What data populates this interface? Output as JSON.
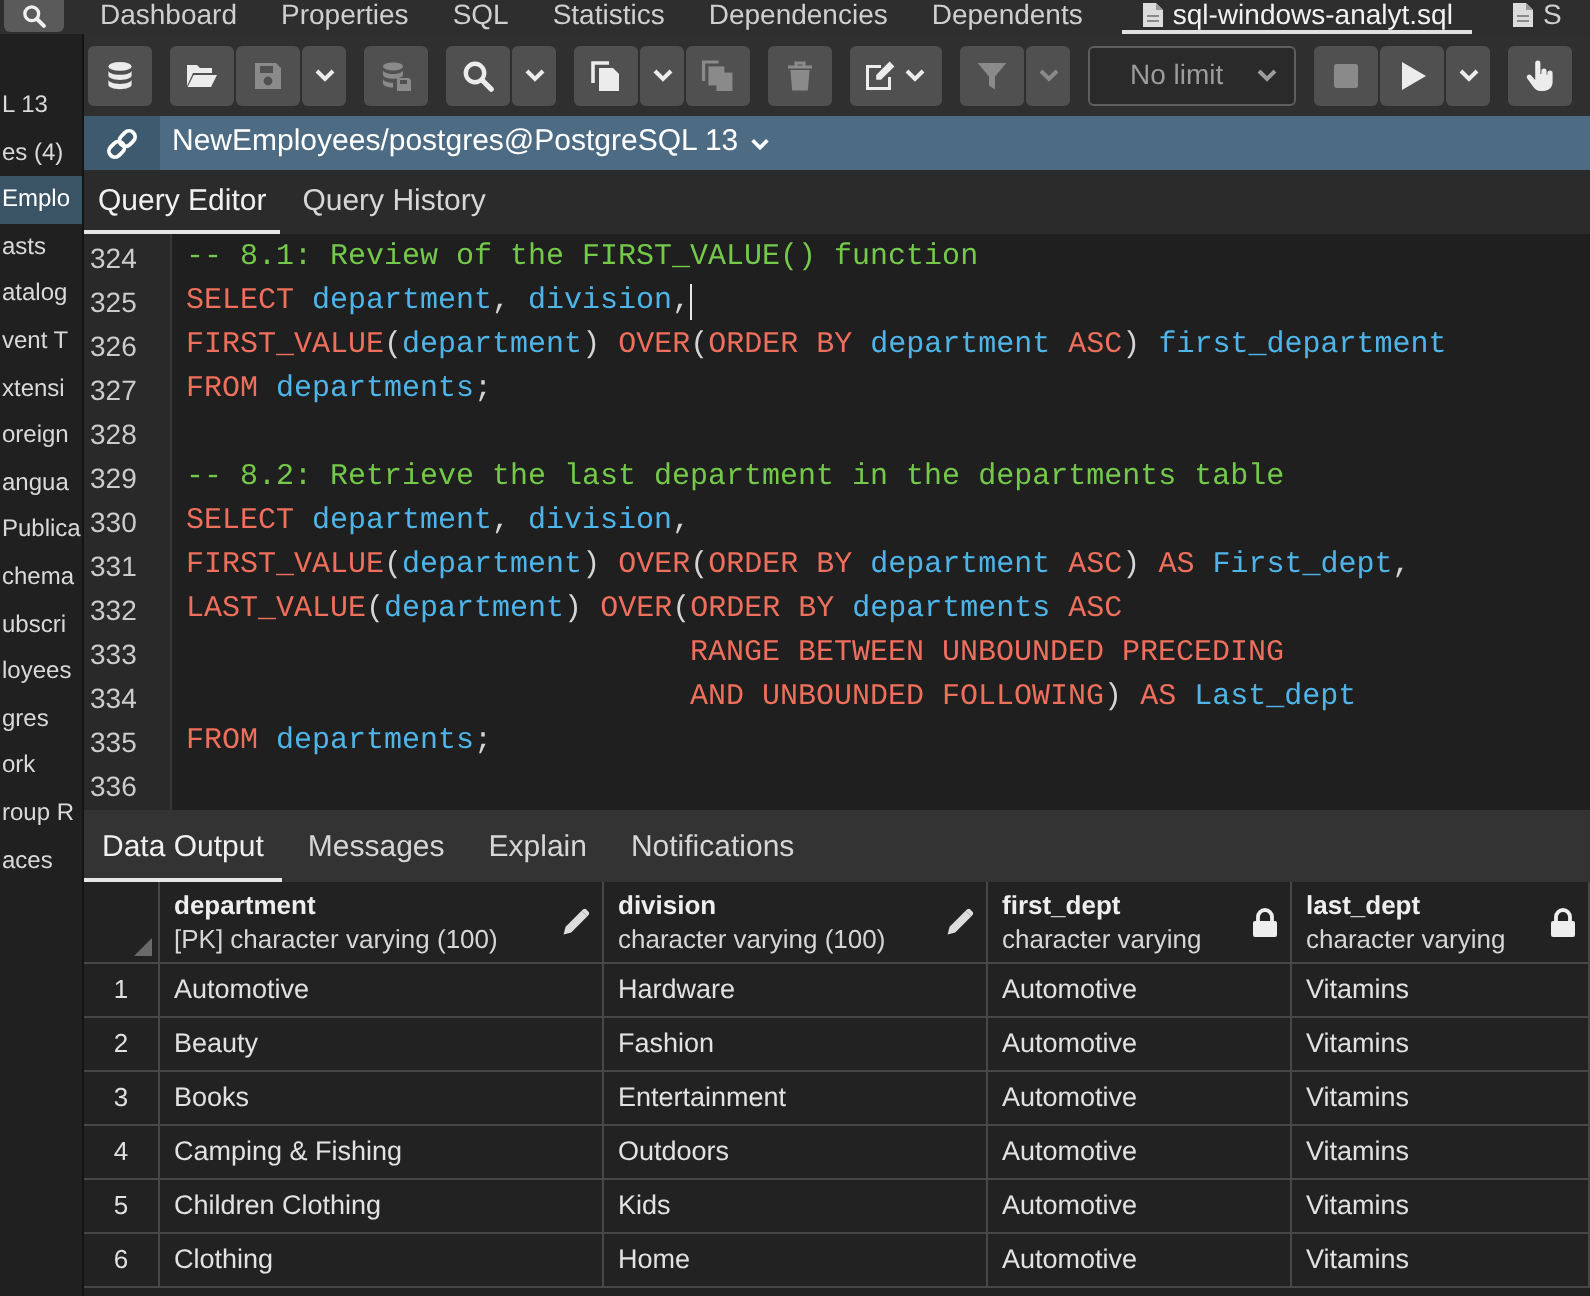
{
  "top_tabs": [
    {
      "label": "Dashboard",
      "selected": false,
      "kind": "plain"
    },
    {
      "label": "Properties",
      "selected": false,
      "kind": "plain"
    },
    {
      "label": "SQL",
      "selected": false,
      "kind": "plain"
    },
    {
      "label": "Statistics",
      "selected": false,
      "kind": "plain"
    },
    {
      "label": "Dependencies",
      "selected": false,
      "kind": "plain"
    },
    {
      "label": "Dependents",
      "selected": false,
      "kind": "plain"
    },
    {
      "label": "sql-windows-analyt.sql",
      "selected": true,
      "kind": "file"
    },
    {
      "label": "S",
      "selected": false,
      "kind": "file"
    }
  ],
  "tree_items": [
    {
      "label": "L 13",
      "selected": false
    },
    {
      "label": "es (4)",
      "selected": false
    },
    {
      "label": "Emplo",
      "selected": true
    },
    {
      "label": "asts",
      "selected": false
    },
    {
      "label": "atalog",
      "selected": false
    },
    {
      "label": "vent T",
      "selected": false
    },
    {
      "label": "xtensi",
      "selected": false
    },
    {
      "label": "oreign",
      "selected": false
    },
    {
      "label": "angua",
      "selected": false
    },
    {
      "label": "Publica",
      "selected": false
    },
    {
      "label": "chema",
      "selected": false
    },
    {
      "label": "ubscri",
      "selected": false
    },
    {
      "label": "loyees",
      "selected": false
    },
    {
      "label": "gres",
      "selected": false
    },
    {
      "label": "ork",
      "selected": false
    },
    {
      "label": "roup R",
      "selected": false
    },
    {
      "label": "aces",
      "selected": false
    }
  ],
  "toolbar": [
    {
      "kind": "buttons",
      "buttons": [
        {
          "kind": "icon",
          "disabled": false
        }
      ]
    },
    {
      "kind": "buttons",
      "buttons": [
        {
          "kind": "icon",
          "disabled": false
        },
        {
          "kind": "icon",
          "disabled": true
        },
        {
          "kind": "caret",
          "disabled": false
        }
      ]
    },
    {
      "kind": "buttons",
      "buttons": [
        {
          "kind": "icon",
          "disabled": true
        }
      ]
    },
    {
      "kind": "buttons",
      "buttons": [
        {
          "kind": "icon",
          "disabled": false
        },
        {
          "kind": "caret",
          "disabled": false
        }
      ]
    },
    {
      "kind": "buttons",
      "buttons": [
        {
          "kind": "icon",
          "disabled": false
        },
        {
          "kind": "caret",
          "disabled": false
        },
        {
          "kind": "icon",
          "disabled": true
        }
      ]
    },
    {
      "kind": "buttons",
      "buttons": [
        {
          "kind": "icon",
          "disabled": true
        }
      ]
    },
    {
      "kind": "buttons",
      "buttons": [
        {
          "kind": "menu",
          "disabled": false
        }
      ]
    },
    {
      "kind": "buttons",
      "buttons": [
        {
          "kind": "icon",
          "disabled": true
        },
        {
          "kind": "caret",
          "disabled": true
        }
      ]
    },
    {
      "kind": "select",
      "value": "No limit"
    },
    {
      "kind": "buttons",
      "buttons": [
        {
          "kind": "icon",
          "disabled": true
        },
        {
          "kind": "icon",
          "disabled": false
        },
        {
          "kind": "caret",
          "disabled": false
        }
      ]
    },
    {
      "kind": "buttons",
      "buttons": [
        {
          "kind": "icon",
          "disabled": false
        }
      ]
    }
  ],
  "connection": {
    "label": "NewEmployees/postgres@PostgreSQL 13"
  },
  "editor_tabs": [
    {
      "label": "Query Editor",
      "selected": true
    },
    {
      "label": "Query History",
      "selected": false
    }
  ],
  "editor": {
    "lines": [
      {
        "number": "324",
        "kind": "line",
        "cursor": false,
        "tokens": [
          {
            "kind": "comment",
            "text": "-- 8.1: Review of the FIRST_VALUE() function"
          }
        ]
      },
      {
        "number": "325",
        "kind": "line",
        "cursor": true,
        "tokens": [
          {
            "kind": "keyword",
            "text": "SELECT "
          },
          {
            "kind": "identifier",
            "text": "department"
          },
          {
            "kind": "plain",
            "text": ", "
          },
          {
            "kind": "identifier",
            "text": "division"
          },
          {
            "kind": "plain",
            "text": ","
          }
        ]
      },
      {
        "number": "326",
        "kind": "line",
        "cursor": false,
        "tokens": [
          {
            "kind": "keyword",
            "text": "FIRST_VALUE"
          },
          {
            "kind": "plain",
            "text": "("
          },
          {
            "kind": "identifier",
            "text": "department"
          },
          {
            "kind": "plain",
            "text": ") "
          },
          {
            "kind": "keyword",
            "text": "OVER"
          },
          {
            "kind": "plain",
            "text": "("
          },
          {
            "kind": "keyword",
            "text": "ORDER BY "
          },
          {
            "kind": "identifier",
            "text": "department "
          },
          {
            "kind": "keyword",
            "text": "ASC"
          },
          {
            "kind": "plain",
            "text": ") "
          },
          {
            "kind": "identifier",
            "text": "first_department"
          }
        ]
      },
      {
        "number": "327",
        "kind": "line",
        "cursor": false,
        "tokens": [
          {
            "kind": "keyword",
            "text": "FROM "
          },
          {
            "kind": "identifier",
            "text": "departments"
          },
          {
            "kind": "plain",
            "text": ";"
          }
        ]
      },
      {
        "number": "328",
        "kind": "blank",
        "cursor": false
      },
      {
        "number": "329",
        "kind": "line",
        "cursor": false,
        "tokens": [
          {
            "kind": "comment",
            "text": "-- 8.2: Retrieve the last department in the departments table"
          }
        ]
      },
      {
        "number": "330",
        "kind": "line",
        "cursor": false,
        "tokens": [
          {
            "kind": "keyword",
            "text": "SELECT "
          },
          {
            "kind": "identifier",
            "text": "department"
          },
          {
            "kind": "plain",
            "text": ", "
          },
          {
            "kind": "identifier",
            "text": "division"
          },
          {
            "kind": "plain",
            "text": ","
          }
        ]
      },
      {
        "number": "331",
        "kind": "line",
        "cursor": false,
        "tokens": [
          {
            "kind": "keyword",
            "text": "FIRST_VALUE"
          },
          {
            "kind": "plain",
            "text": "("
          },
          {
            "kind": "identifier",
            "text": "department"
          },
          {
            "kind": "plain",
            "text": ") "
          },
          {
            "kind": "keyword",
            "text": "OVER"
          },
          {
            "kind": "plain",
            "text": "("
          },
          {
            "kind": "keyword",
            "text": "ORDER BY "
          },
          {
            "kind": "identifier",
            "text": "department "
          },
          {
            "kind": "keyword",
            "text": "ASC"
          },
          {
            "kind": "plain",
            "text": ") "
          },
          {
            "kind": "keyword",
            "text": "AS "
          },
          {
            "kind": "identifier",
            "text": "First_dept"
          },
          {
            "kind": "plain",
            "text": ","
          }
        ]
      },
      {
        "number": "332",
        "kind": "line",
        "cursor": false,
        "tokens": [
          {
            "kind": "keyword",
            "text": "LAST_VALUE"
          },
          {
            "kind": "plain",
            "text": "("
          },
          {
            "kind": "identifier",
            "text": "department"
          },
          {
            "kind": "plain",
            "text": ") "
          },
          {
            "kind": "keyword",
            "text": "OVER"
          },
          {
            "kind": "plain",
            "text": "("
          },
          {
            "kind": "keyword",
            "text": "ORDER BY "
          },
          {
            "kind": "identifier",
            "text": "departments "
          },
          {
            "kind": "keyword",
            "text": "ASC"
          }
        ]
      },
      {
        "number": "333",
        "kind": "continuation",
        "cursor": false,
        "tokens": [
          {
            "kind": "keyword",
            "text": "RANGE BETWEEN UNBOUNDED PRECEDING"
          }
        ]
      },
      {
        "number": "334",
        "kind": "continuation",
        "cursor": false,
        "tokens": [
          {
            "kind": "keyword",
            "text": "AND UNBOUNDED FOLLOWING"
          },
          {
            "kind": "plain",
            "text": ") "
          },
          {
            "kind": "keyword",
            "text": "AS "
          },
          {
            "kind": "identifier",
            "text": "Last_dept"
          }
        ]
      },
      {
        "number": "335",
        "kind": "line",
        "cursor": false,
        "tokens": [
          {
            "kind": "keyword",
            "text": "FROM "
          },
          {
            "kind": "identifier",
            "text": "departments"
          },
          {
            "kind": "plain",
            "text": ";"
          }
        ]
      },
      {
        "number": "336",
        "kind": "blank",
        "cursor": false
      }
    ]
  },
  "output_tabs": [
    {
      "label": "Data Output",
      "selected": true
    },
    {
      "label": "Messages",
      "selected": false
    },
    {
      "label": "Explain",
      "selected": false
    },
    {
      "label": "Notifications",
      "selected": false
    }
  ],
  "table": {
    "columns": [
      {
        "name": "department",
        "type": "[PK] character varying (100)",
        "editable": true
      },
      {
        "name": "division",
        "type": "character varying (100)",
        "editable": true
      },
      {
        "name": "first_dept",
        "type": "character varying",
        "editable": false
      },
      {
        "name": "last_dept",
        "type": "character varying",
        "editable": false
      }
    ],
    "rows": [
      {
        "number": "1",
        "cells": [
          "Automotive",
          "Hardware",
          "Automotive",
          "Vitamins"
        ]
      },
      {
        "number": "2",
        "cells": [
          "Beauty",
          "Fashion",
          "Automotive",
          "Vitamins"
        ]
      },
      {
        "number": "3",
        "cells": [
          "Books",
          "Entertainment",
          "Automotive",
          "Vitamins"
        ]
      },
      {
        "number": "4",
        "cells": [
          "Camping & Fishing",
          "Outdoors",
          "Automotive",
          "Vitamins"
        ]
      },
      {
        "number": "5",
        "cells": [
          "Children Clothing",
          "Kids",
          "Automotive",
          "Vitamins"
        ]
      },
      {
        "number": "6",
        "cells": [
          "Clothing",
          "Home",
          "Automotive",
          "Vitamins"
        ]
      }
    ]
  }
}
